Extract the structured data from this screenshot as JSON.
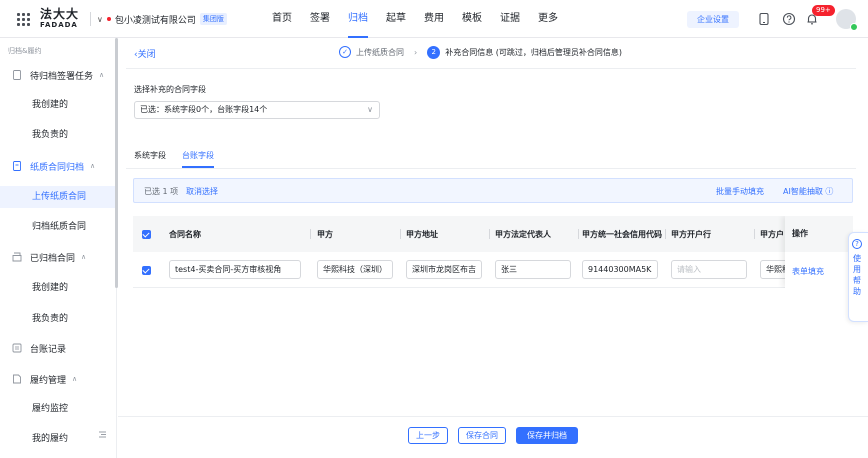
{
  "header": {
    "logo_cn": "法大大",
    "logo_en": "FADADA",
    "company_name": "包小凌测试有限公司",
    "company_tag": "集团版",
    "nav": [
      "首页",
      "签署",
      "归档",
      "起草",
      "费用",
      "模板",
      "证据",
      "更多"
    ],
    "nav_active": "归档",
    "enterprise_settings": "企业设置",
    "notification_badge": "99+",
    "icons": [
      "grid-icon",
      "tablet-icon",
      "help-circle-icon",
      "bell-icon",
      "avatar"
    ]
  },
  "sidebar": {
    "section_title": "归档&履约",
    "groups": [
      {
        "label": "待归档签署任务",
        "items": [
          "我创建的",
          "我负责的"
        ]
      },
      {
        "label": "纸质合同归档",
        "items": [
          "上传纸质合同",
          "归档纸质合同"
        ],
        "active_item": "上传纸质合同"
      },
      {
        "label": "已归档合同",
        "items": [
          "我创建的",
          "我负责的"
        ]
      },
      {
        "label": "台账记录",
        "items": []
      },
      {
        "label": "履约管理",
        "items": [
          "履约监控",
          "我的履约"
        ]
      }
    ],
    "collapse_icon": "menu-fold-icon"
  },
  "page": {
    "close_label": "关闭",
    "steps": {
      "step1": "上传纸质合同",
      "step2_num": "2",
      "step2": "补充合同信息 (可跳过，归档后管理员补合同信息)"
    },
    "field_label": "选择补充的合同字段",
    "select_value": "已选：系统字段0个，台账字段14个",
    "tabs": [
      "系统字段",
      "台账字段"
    ],
    "active_tab": "台账字段",
    "selection_bar": {
      "count": "已选 1 项",
      "cancel": "取消选择",
      "batch_fill": "批量手动填充",
      "ai_extract": "AI智能抽取"
    },
    "table": {
      "columns": [
        "合同名称",
        "甲方",
        "甲方地址",
        "甲方法定代表人",
        "甲方统一社会信用代码",
        "甲方开户行",
        "甲方户"
      ],
      "action_header": "操作",
      "rows": [
        {
          "checked": true,
          "values": [
            "test4-买卖合同-买方审核视角",
            "华熙科技（深圳）",
            "深圳市龙岗区布吉",
            "张三",
            "91440300MA5K",
            "",
            "华熙科"
          ],
          "placeholder_bank": "请输入",
          "action": "表单填充"
        }
      ]
    },
    "float_help": "使用帮助"
  },
  "footer": {
    "prev": "上一步",
    "save": "保存合同",
    "save_archive": "保存并归档"
  },
  "colors": {
    "primary": "#3370ff",
    "badge": "#f5222d",
    "text": "#1f2329",
    "muted": "#8f959e"
  }
}
